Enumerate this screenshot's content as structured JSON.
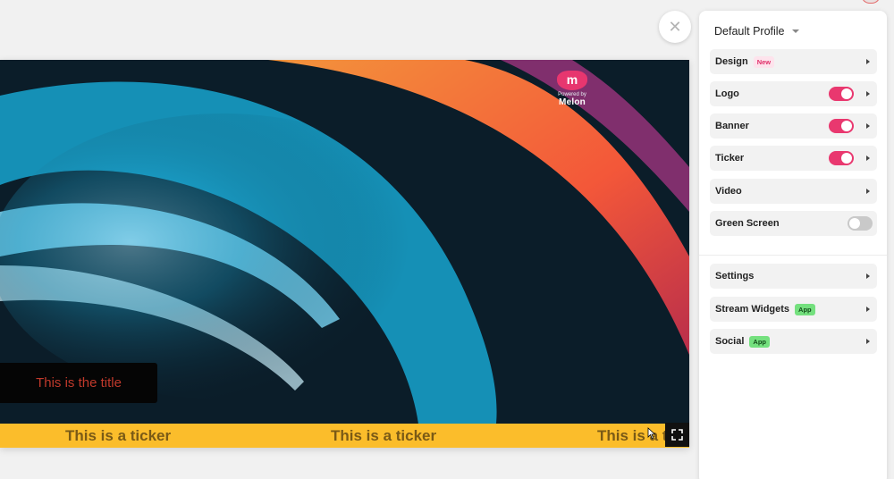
{
  "window": {
    "close_glyph": "✕"
  },
  "preview": {
    "logo": {
      "mark": "m",
      "powered_by": "Powered by",
      "name": "Melon",
      "color": "#e7366f"
    },
    "title_text": "This is the title",
    "ticker": {
      "items": [
        "This is a ticker",
        "This is a ticker",
        "This is a ticker"
      ],
      "color": "#fbbd2b"
    }
  },
  "panel": {
    "profile_name": "Default Profile",
    "sections": [
      {
        "label": "Design",
        "badge": "New"
      },
      {
        "label": "Logo",
        "toggle": "on"
      },
      {
        "label": "Banner",
        "toggle": "on"
      },
      {
        "label": "Ticker",
        "toggle": "on"
      },
      {
        "label": "Video"
      },
      {
        "label": "Green Screen",
        "toggle": "off"
      }
    ],
    "extras": [
      {
        "label": "Settings"
      },
      {
        "label": "Stream Widgets",
        "badge": "App"
      },
      {
        "label": "Social",
        "badge": "App"
      }
    ],
    "accent_color": "#e9386f"
  }
}
